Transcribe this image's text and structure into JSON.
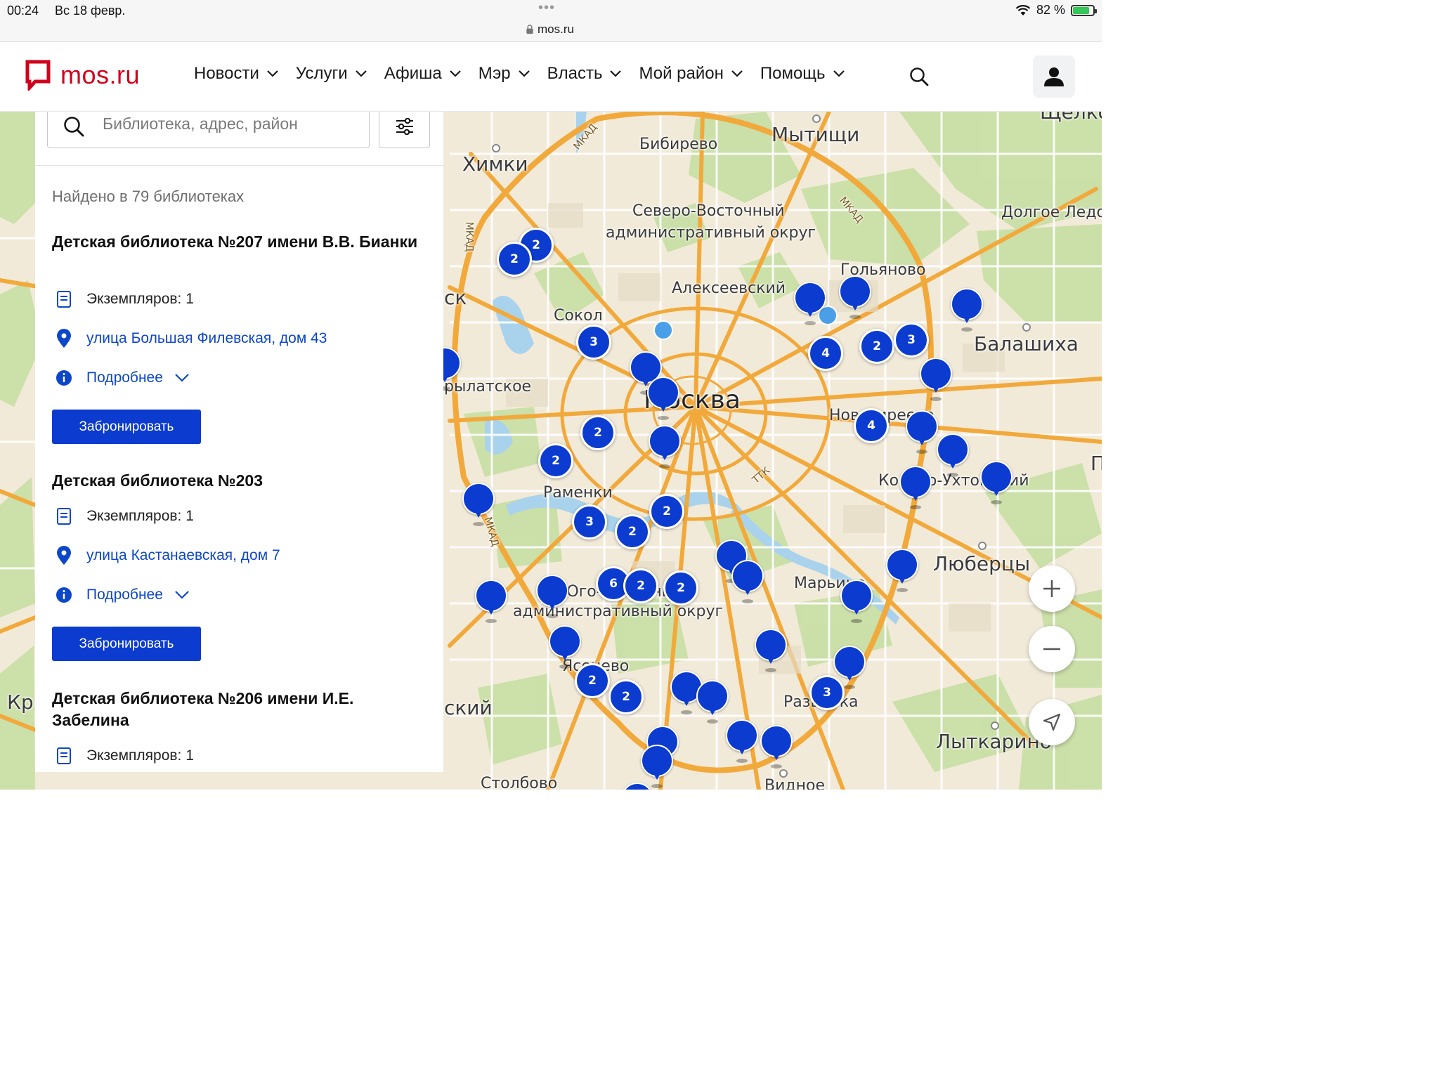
{
  "status_bar": {
    "time": "00:24",
    "date": "Вс 18 февр.",
    "dots": "•••",
    "url": "mos.ru",
    "battery": "82 %",
    "battery_level": 0.82
  },
  "header": {
    "logo_text": "mos.ru",
    "nav": [
      "Новости",
      "Услуги",
      "Афиша",
      "Мэр",
      "Власть",
      "Мой район",
      "Помощь"
    ]
  },
  "search": {
    "placeholder": "Библиотека, адрес, район"
  },
  "panel": {
    "found_text": "Найдено в 79 библиотеках",
    "libraries": [
      {
        "title": "Детская библиотека №207 имени В.В. Бианки",
        "copies": "Экземпляров: 1",
        "address": "улица Большая Филевская, дом 43",
        "details": "Подробнее",
        "book_button": "Забронировать"
      },
      {
        "title": "Детская библиотека №203",
        "copies": "Экземпляров: 1",
        "address": "улица Кастанаевская, дом 7",
        "details": "Подробнее",
        "book_button": "Забронировать"
      },
      {
        "title": "Детская библиотека №206 имени И.Е. Забелина",
        "copies": "Экземпляров: 1"
      }
    ]
  },
  "map": {
    "labels": {
      "khimki": "Химки",
      "mytishchi": "Мытищи",
      "bibirevo": "Бибирево",
      "svao_1": "Северо-Восточный",
      "svao_2": "административный округ",
      "dolgoe": "Долгое Ледо",
      "golyanovo": "Гольяново",
      "alekseevsky": "Алексеевский",
      "sokol": "Сокол",
      "balashikha": "Балашиха",
      "krylatskoe": "рылатское",
      "moskva": "Москва",
      "novogireevo": "Новогиреево",
      "ramenki": "Раменки",
      "kosino": "Косино-Ухтомский",
      "lyubertsy": "Люберцы",
      "maryino": "Марьино",
      "yuzao_1": "Юго-Западный",
      "yuzao_2": "административный округ",
      "yasenevo": "Ясенево",
      "razvilka": "Развилка",
      "lytkarino": "Лыткарино",
      "stolbovo": "Столбово",
      "vidnoe": "Видное",
      "schelkovo": "Щелко",
      "kr": "Кр",
      "sk": "ск",
      "skiy": "ский",
      "mkad": "МКАД",
      "ttk": "ТТК",
      "p": "П"
    },
    "clusters": [
      "2",
      "2",
      "3",
      "4",
      "2",
      "3",
      "4",
      "2",
      "2",
      "3",
      "2",
      "2",
      "6",
      "2",
      "2",
      "2",
      "2",
      "3"
    ]
  }
}
